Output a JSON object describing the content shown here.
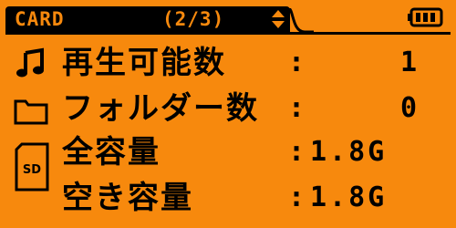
{
  "header": {
    "title": "CARD",
    "page_indicator": "(2/3)"
  },
  "rows": [
    {
      "label": "再生可能数",
      "value": "1",
      "icon": "music-note-icon"
    },
    {
      "label": "フォルダー数",
      "value": "0",
      "icon": "folder-icon"
    },
    {
      "label": "全容量",
      "value": "1.8G",
      "icon": "sd-card-icon"
    },
    {
      "label": "空き容量",
      "value": "1.8G",
      "icon": ""
    }
  ],
  "colon": ":",
  "sd_label": "SD",
  "colors": {
    "background": "#f7890d",
    "foreground": "#000000"
  }
}
